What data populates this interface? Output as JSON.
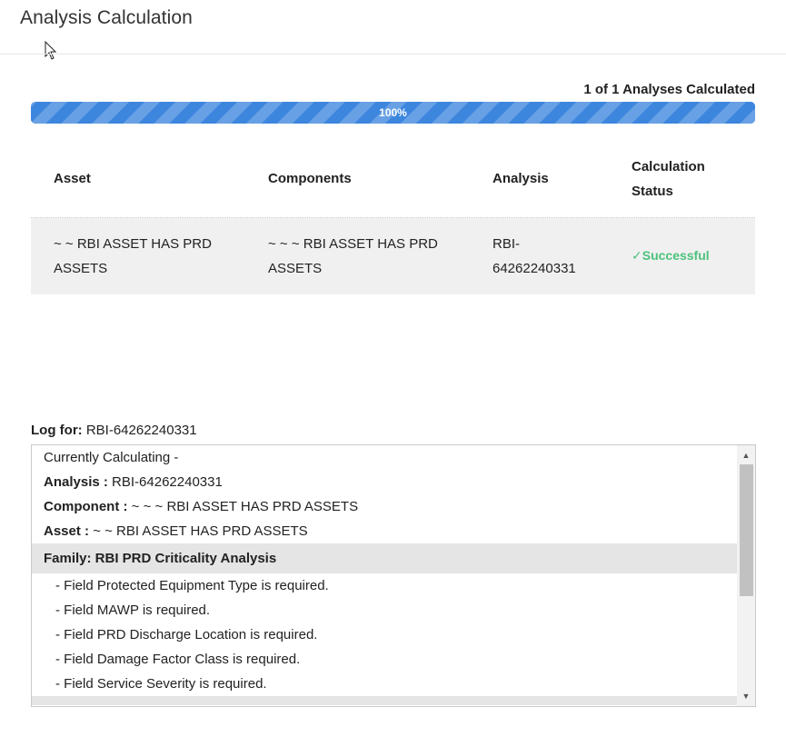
{
  "page": {
    "title": "Analysis Calculation"
  },
  "progress": {
    "summary": "1 of 1 Analyses Calculated",
    "label": "100%",
    "fraction": 1.0,
    "color": "#3d86de"
  },
  "table": {
    "headers": {
      "asset": "Asset",
      "components": "Components",
      "analysis": "Analysis",
      "status_line1": "Calculation",
      "status_line2": "Status"
    },
    "rows": [
      {
        "asset_line1": "~ ~ RBI ASSET HAS PRD",
        "asset_line2": "ASSETS",
        "components_line1": "~ ~ ~ RBI ASSET HAS PRD",
        "components_line2": "ASSETS",
        "analysis_line1": "RBI-",
        "analysis_line2": "64262240331",
        "status_icon": "check-icon",
        "status": "Successful",
        "status_color": "#4cc27c"
      }
    ]
  },
  "log": {
    "label": "Log for:",
    "analysis_id": "RBI-64262240331",
    "lines": {
      "calculating": "Currently Calculating -",
      "analysis_key": "Analysis :",
      "analysis_value": "RBI-64262240331",
      "component_key": "Component :",
      "component_value": "~ ~ ~ RBI ASSET HAS PRD ASSETS",
      "asset_key": "Asset :",
      "asset_value": "~ ~ RBI ASSET HAS PRD ASSETS",
      "family": "Family: RBI PRD Criticality Analysis"
    },
    "items": [
      "- Field Protected Equipment Type is required.",
      "- Field MAWP is required.",
      "- Field PRD Discharge Location is required.",
      "- Field Damage Factor Class is required.",
      "- Field Service Severity is required."
    ],
    "scroll_up_icon": "triangle-up-icon",
    "scroll_down_icon": "triangle-down-icon"
  }
}
